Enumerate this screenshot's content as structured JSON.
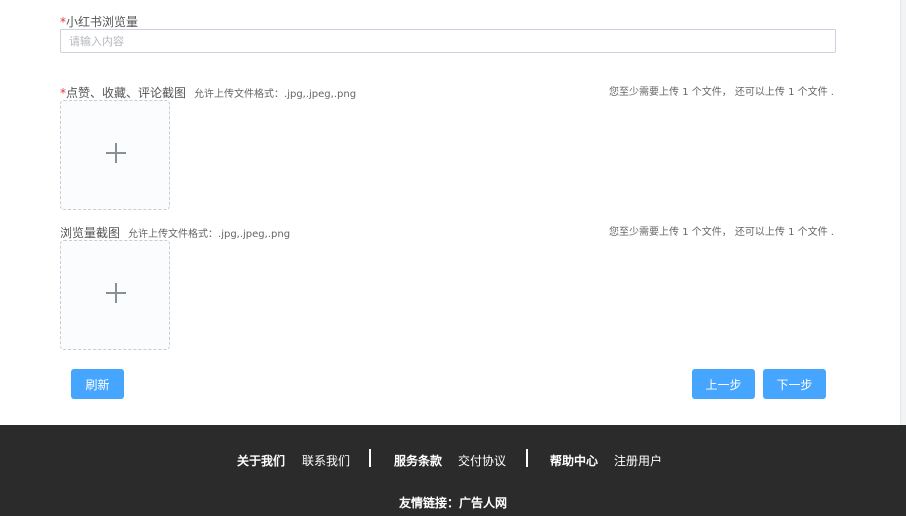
{
  "form": {
    "views_field": {
      "required_mark": "*",
      "label": "小红书浏览量",
      "placeholder": "请输入内容",
      "value": ""
    },
    "likes_screenshot": {
      "required_mark": "*",
      "label": "点赞、收藏、评论截图",
      "hint": "允许上传文件格式：.jpg,.jpeg,.png",
      "rule": "您至少需要上传 1 个文件，  还可以上传 1 个文件 ."
    },
    "views_screenshot": {
      "label": "浏览量截图",
      "hint": "允许上传文件格式：.jpg,.jpeg,.png",
      "rule": "您至少需要上传 1 个文件，  还可以上传 1 个文件 ."
    },
    "buttons": {
      "refresh": "刷新",
      "prev": "上一步",
      "next": "下一步"
    }
  },
  "footer": {
    "links": {
      "about": "关于我们",
      "contact": "联系我们",
      "terms": "服务条款",
      "delivery": "交付协议",
      "help": "帮助中心",
      "register": "注册用户"
    },
    "friend_links": "友情链接：广告人网"
  },
  "colors": {
    "accent": "#46a6ff",
    "required": "#e0363b",
    "footer_bg": "#2b2b2b"
  }
}
